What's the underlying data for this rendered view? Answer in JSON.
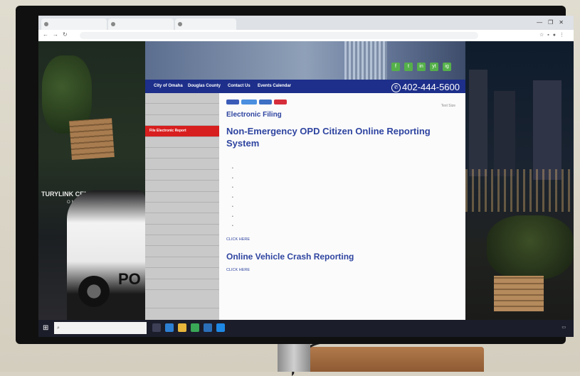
{
  "browser": {
    "tabs": [
      "",
      "",
      ""
    ],
    "url": "",
    "window_controls": [
      "—",
      "❐",
      "✕"
    ]
  },
  "background": {
    "arena_sign": "TURYLINK CENTE",
    "arena_sub": "OMI",
    "car_text": "PO"
  },
  "site": {
    "nav": {
      "links": [
        "City of Omaha",
        "Douglas County",
        "Contact Us",
        "Events Calendar"
      ],
      "phone": "402-444-5600"
    },
    "social_icons": [
      "f",
      "t",
      "in",
      "yt",
      "ig"
    ],
    "sidebar": {
      "items": [
        "",
        "",
        "",
        "File Electronic Report",
        "",
        "",
        "",
        "",
        "",
        "",
        "",
        "",
        "",
        "",
        "",
        "",
        "",
        "",
        "",
        ""
      ]
    },
    "content": {
      "text_size": "Text Size",
      "section_label": "Electronic Filing",
      "title": "Non-Emergency OPD Citizen Online Reporting System",
      "intro": "",
      "bullets": [
        "",
        "",
        "",
        "",
        "",
        "",
        ""
      ],
      "report_prefix": "",
      "report_link": "CLICK HERE",
      "crash_heading": "Online Vehicle Crash Reporting",
      "crash_prefix": "",
      "crash_link": "CLICK HERE",
      "red_note": ""
    }
  },
  "taskbar": {
    "search_placeholder": "",
    "clock_time": "",
    "clock_date": ""
  },
  "colors": {
    "navbar": "#1d2f8a",
    "accent_red": "#d81f1f",
    "title_blue": "#2e44a0",
    "social_green": "#55b04a"
  }
}
